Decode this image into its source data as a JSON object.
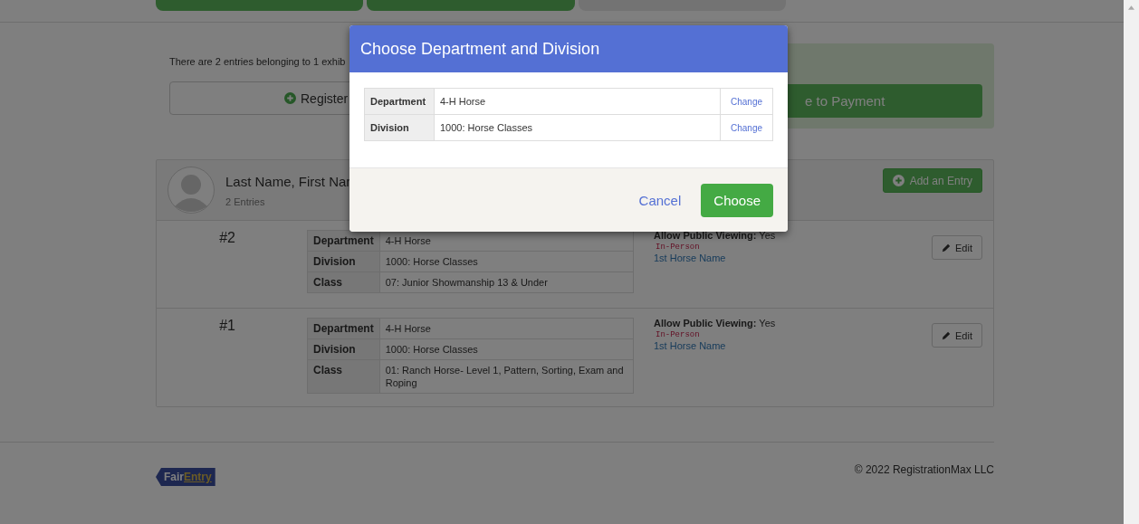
{
  "progress_steps": [
    {
      "complete": true
    },
    {
      "complete": true
    },
    {
      "complete": false
    }
  ],
  "summary": {
    "text": "There are 2 entries belonging to 1 exhib",
    "register_button": "Register",
    "payment_button": "e to Payment"
  },
  "exhibitor": {
    "name": "Last Name, First Nar",
    "count": "2 Entries",
    "add_button": "Add an Entry",
    "entries": [
      {
        "number": "#2",
        "details": [
          {
            "label": "Department",
            "value": "4-H Horse"
          },
          {
            "label": "Division",
            "value": "1000: Horse Classes"
          },
          {
            "label": "Class",
            "value": "07: Junior Showmanship 13 & Under"
          }
        ],
        "viewing_label": "Allow Public Viewing:",
        "viewing_value": "Yes",
        "tag": "In-Person",
        "horse": "1st Horse Name",
        "edit_button": "Edit"
      },
      {
        "number": "#1",
        "details": [
          {
            "label": "Department",
            "value": "4-H Horse"
          },
          {
            "label": "Division",
            "value": "1000: Horse Classes"
          },
          {
            "label": "Class",
            "value": "01: Ranch Horse- Level 1, Pattern, Sorting, Exam and Roping"
          }
        ],
        "viewing_label": "Allow Public Viewing:",
        "viewing_value": "Yes",
        "tag": "In-Person",
        "horse": "1st Horse Name",
        "edit_button": "Edit"
      }
    ]
  },
  "footer": {
    "logo": [
      "Fair",
      "Entry"
    ],
    "copyright": "© 2022 RegistrationMax LLC"
  },
  "modal": {
    "title": "Choose Department and Division",
    "rows": [
      {
        "label": "Department",
        "value": "4-H Horse",
        "action": "Change"
      },
      {
        "label": "Division",
        "value": "1000: Horse Classes",
        "action": "Change"
      }
    ],
    "cancel": "Cancel",
    "choose": "Choose"
  }
}
